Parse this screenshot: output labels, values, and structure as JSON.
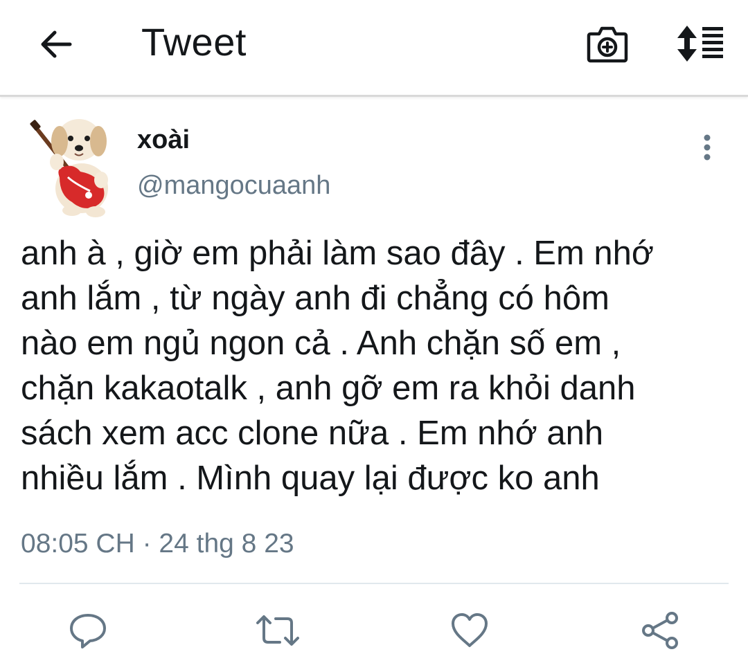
{
  "header": {
    "title": "Tweet",
    "back_icon": "arrow-left-icon",
    "camera_icon": "camera-add-icon",
    "sort_icon": "sort-list-icon"
  },
  "tweet": {
    "display_name": "xoài",
    "handle": "@mangocuaanh",
    "avatar_icon": "puppy-guitar-avatar",
    "text": "anh à , giờ em phải làm sao đây . Em nhớ\nanh lắm , từ ngày anh đi chẳng có hôm\nnào em ngủ ngon cả . Anh chặn số em ,\nchặn kakaotalk , anh gỡ em ra khỏi danh\nsách xem acc clone nữa . Em nhớ anh\nnhiều lắm . Mình quay lại được ko anh",
    "timestamp": "08:05 CH · 24 thg 8 23"
  },
  "actions": [
    {
      "name": "reply",
      "icon": "speech-bubble-icon"
    },
    {
      "name": "retweet",
      "icon": "retweet-icon"
    },
    {
      "name": "like",
      "icon": "heart-icon"
    },
    {
      "name": "share",
      "icon": "share-icon"
    }
  ],
  "colors": {
    "text_primary": "#14171a",
    "text_secondary": "#657786",
    "icon_color": "#657786",
    "divider": "#e1e8ed"
  }
}
